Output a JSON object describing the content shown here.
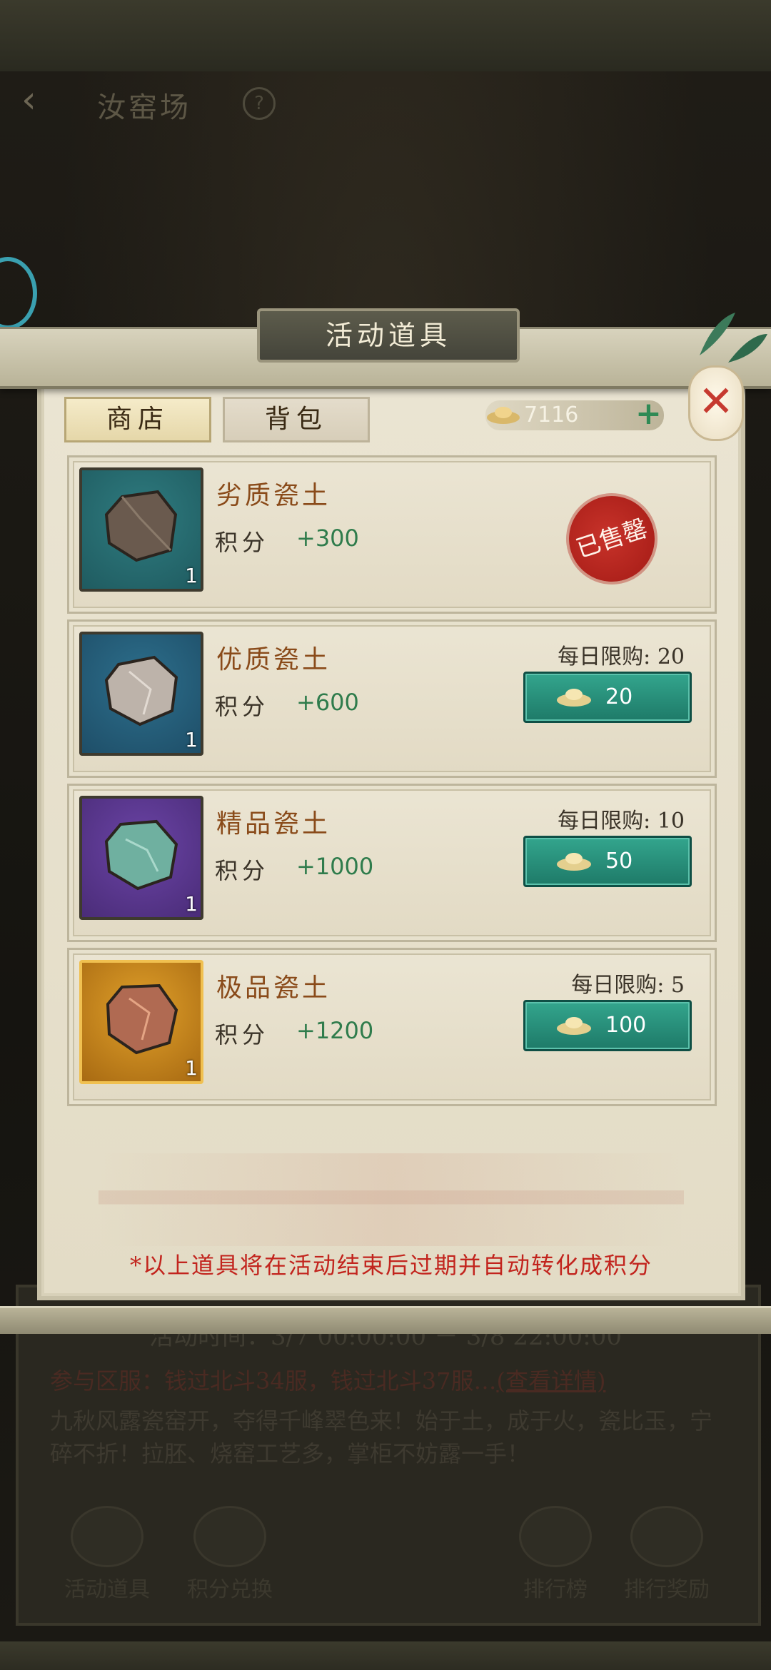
{
  "header": {
    "page_title": "汝窑场"
  },
  "background_panel": {
    "activity_time": "活动时间：3/7 00:00:00 － 3/8 22:00:00",
    "servers_prefix": "参与区服：钱过北斗34服，钱过北斗37服…",
    "servers_link": "(查看详情)",
    "description": "九秋风露瓷窑开，夺得千峰翠色来！始于土，成于火，瓷比玉，宁碎不折！拉胚、烧窑工艺多，掌柜不妨露一手！",
    "bottom_buttons": [
      "活动道具",
      "积分兑换",
      "排行榜",
      "排行奖励"
    ]
  },
  "modal": {
    "title": "活动道具",
    "tabs": [
      "商店",
      "背包"
    ],
    "currency_amount": "7116",
    "footnote": "*以上道具将在活动结束后过期并自动转化成积分"
  },
  "items": [
    {
      "name": "劣质瓷土",
      "points_label": "积分",
      "points": "+300",
      "qty": "1",
      "sold_out": "已售罄",
      "thumb_bg": "#1f5b60",
      "rock_color": "#6a5a4e"
    },
    {
      "name": "优质瓷土",
      "points_label": "积分",
      "points": "+600",
      "qty": "1",
      "limit": "每日限购: 20",
      "price": "20",
      "thumb_bg": "#1e4e68",
      "rock_color": "#bdb3aa"
    },
    {
      "name": "精品瓷土",
      "points_label": "积分",
      "points": "+1000",
      "qty": "1",
      "limit": "每日限购: 10",
      "price": "50",
      "thumb_bg": "#4a2c78",
      "rock_color": "#6fb0a0"
    },
    {
      "name": "极品瓷土",
      "points_label": "积分",
      "points": "+1200",
      "qty": "1",
      "limit": "每日限购: 5",
      "price": "100",
      "thumb_bg": "#a86a12",
      "rock_color": "#b06a52"
    }
  ],
  "colors": {
    "accent_green": "#2f7c4c",
    "buy_button": "#2a9680",
    "sold_stamp": "#b8241c",
    "footnote_red": "#c2241d"
  }
}
